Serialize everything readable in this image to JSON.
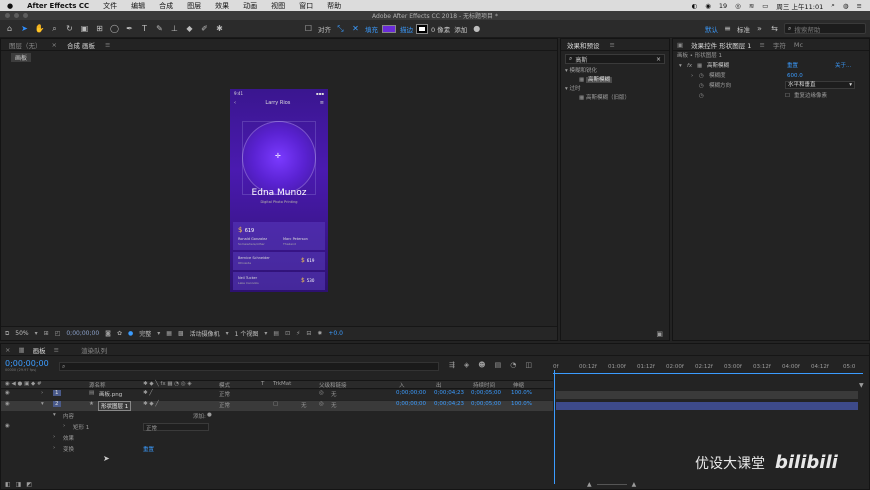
{
  "menubar": {
    "apple": "",
    "app": "After Effects CC",
    "items": [
      "文件",
      "编辑",
      "合成",
      "图层",
      "效果",
      "动画",
      "视图",
      "窗口",
      "帮助"
    ],
    "badge": "19",
    "clock": "周三 上午11:01"
  },
  "titlebar": {
    "title": "Adobe After Effects CC 2018 - 无标题项目 *"
  },
  "toolbar": {
    "align": "对齐",
    "fill": "填充",
    "stroke": "描边",
    "pixels": "0 像素",
    "add": "添加",
    "default": "默认",
    "std": "标准",
    "search_placeholder": "搜索帮助",
    "fill_color": "#6a2cd8",
    "stroke_color": "#ffffff"
  },
  "left_panel": {
    "tab_layer": "图层（无）",
    "tab_comp": "合成 画板",
    "crumb": "画板",
    "zoom": "50%",
    "timecode": "0;00;00;00",
    "quality": "完整",
    "camera": "活动摄像机",
    "views": "1 个视图",
    "offset": "+0.0"
  },
  "phone": {
    "time": "9:41",
    "header_name": "Larry Rios",
    "name": "Edna Munoz",
    "subtitle": "Digital Photo Printing",
    "card1_amount": "619",
    "card1_name1": "Ronald Gonzalez",
    "card1_sub1": "Somewhere/other",
    "card1_name2": "Marc Peterson",
    "card1_sub2": "Thailand",
    "card2_name": "Bernice Schneider",
    "card2_sub": "Ohioside",
    "card2_amount": "619",
    "card3_name": "Neil Tucker",
    "card3_sub": "Lake Cannolis",
    "card3_amount": "530"
  },
  "effects_panel": {
    "tab": "效果和预设",
    "search": "高斯",
    "group1": "模糊和锐化",
    "item1": "高斯模糊",
    "group2": "过时",
    "item2": "高斯模糊（旧版）"
  },
  "effect_controls": {
    "tab": "效果控件 形状图层 1",
    "tab2": "字符",
    "tab3": "Mc",
    "crumb": "画板 • 形状图层 1",
    "fx_name": "高斯模糊",
    "reset": "重置",
    "about": "关于...",
    "blur_label": "模糊度",
    "blur_value": "600.0",
    "dir_label": "模糊方向",
    "dir_value": "水平和垂直",
    "repeat_label": "重复边缘像素"
  },
  "timeline": {
    "tab_comp": "画板",
    "tab_render": "渲染队列",
    "timecode": "0;00;00;00",
    "fps": "00000 (29.97 fps)",
    "cols": {
      "name": "源名称",
      "mode": "模式",
      "t": "T",
      "trkmat": "TrkMat",
      "parent": "父级和链接",
      "in": "入",
      "out": "出",
      "dur": "持续时间",
      "stretch": "伸缩"
    },
    "layers": [
      {
        "num": "1",
        "name": "画板.png",
        "mode": "正常",
        "parent": "无",
        "in": "0;00;00;00",
        "out": "0;00;04;23",
        "dur": "0;00;05;00",
        "stretch": "100.0%"
      },
      {
        "num": "2",
        "name": "形状图层 1",
        "mode": "正常",
        "parent": "无",
        "in": "0;00;00;00",
        "out": "0;00;04;23",
        "dur": "0;00;05;00",
        "stretch": "100.0%"
      }
    ],
    "sub_content": "内容",
    "sub_add": "添加:",
    "sub_rect": "矩形 1",
    "sub_rect_mode": "正常",
    "sub_effects": "效果",
    "sub_transform": "变换",
    "sub_reset": "重置",
    "ruler": [
      "0f",
      "00:12f",
      "01:00f",
      "01:12f",
      "02:00f",
      "02:12f",
      "03:00f",
      "03:12f",
      "04:00f",
      "04:12f",
      "05:0"
    ]
  },
  "watermark": {
    "text": "优设大课堂",
    "logo": "bilibili"
  }
}
